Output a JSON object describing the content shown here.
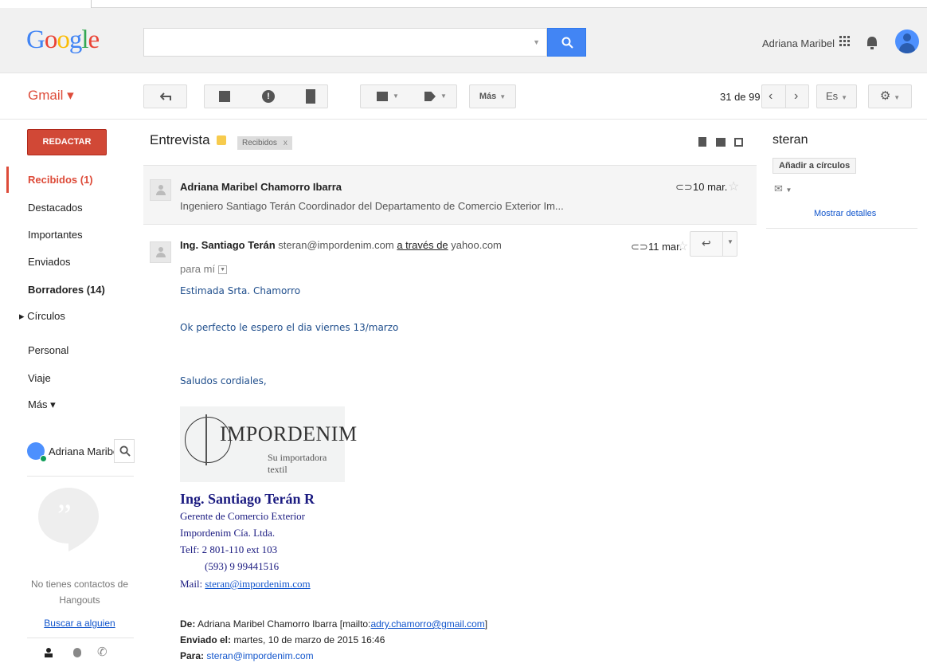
{
  "header": {
    "logo": [
      "G",
      "o",
      "o",
      "g",
      "l",
      "e"
    ],
    "search_placeholder": "",
    "user_name": "Adriana Maribel"
  },
  "toolbar": {
    "app_label": "Gmail ▾",
    "more_label": "Más",
    "counter": "31 de 99",
    "lang_label": "Es"
  },
  "sidebar": {
    "compose_label": "REDACTAR",
    "items": [
      {
        "label": "Recibidos (1)"
      },
      {
        "label": "Destacados"
      },
      {
        "label": "Importantes"
      },
      {
        "label": "Enviados"
      },
      {
        "label": "Borradores (14)"
      },
      {
        "label": "▸ Círculos"
      },
      {
        "label": "Personal"
      },
      {
        "label": "Viaje"
      },
      {
        "label": "Más ▾"
      }
    ],
    "hangouts_user": "Adriana Maribel",
    "no_contacts": "No tienes contactos de Hangouts",
    "find_link": "Buscar a alguien"
  },
  "thread": {
    "subject": "Entrevista",
    "label_chip": "Recibidos",
    "label_chip_close": "x",
    "messages": [
      {
        "sender": "Adriana Maribel Chamorro Ibarra",
        "snippet": "Ingeniero Santiago Terán Coordinador del Departamento de Comercio Exterior Im...",
        "date": "10 mar."
      },
      {
        "sender": "Ing. Santiago Terán",
        "email": "steran@impordenim.com",
        "via": "a través de",
        "via_domain": "yahoo.com",
        "to": "para mí",
        "date": "11 mar."
      }
    ],
    "body": {
      "greeting": "Estimada Srta. Chamorro",
      "line1": "Ok perfecto le espero el dia viernes 13/marzo",
      "closing": "Saludos cordiales,"
    },
    "logo": {
      "name": "IMPORDENIM",
      "tagline": "Su importadora textil"
    },
    "signature": {
      "name": "Ing. Santiago Terán R",
      "title": "Gerente de Comercio Exterior",
      "company": "Impordenim Cía. Ltda.",
      "phone1": "Telf: 2 801-110 ext 103",
      "phone2": "(593) 9 99441516",
      "mail_label": "Mail:",
      "mail": "steran@impordenim.com"
    },
    "forward": {
      "from_label": "De:",
      "from_name": "Adriana Maribel Chamorro Ibarra [mailto:",
      "from_mail": "adry.chamorro@gmail.com",
      "from_close": "]",
      "sent_label": "Enviado el:",
      "sent_value": "martes, 10 de marzo de 2015 16:46",
      "to_label": "Para:",
      "to_value": "steran@impordenim.com"
    }
  },
  "contact_panel": {
    "name": "steran",
    "add_circles": "Añadir a círculos",
    "show_details": "Mostrar detalles"
  },
  "colors": {
    "accent_red": "#dd4b39",
    "compose_red": "#d14836",
    "search_blue": "#4285f4",
    "link_blue": "#1155cc"
  },
  "icons": [
    "search-icon",
    "apps-icon",
    "bell-icon",
    "reply-icon",
    "archive-icon",
    "spam-icon",
    "trash-icon",
    "folder-icon",
    "tag-icon",
    "gear-icon",
    "star-icon",
    "paperclip-icon"
  ]
}
